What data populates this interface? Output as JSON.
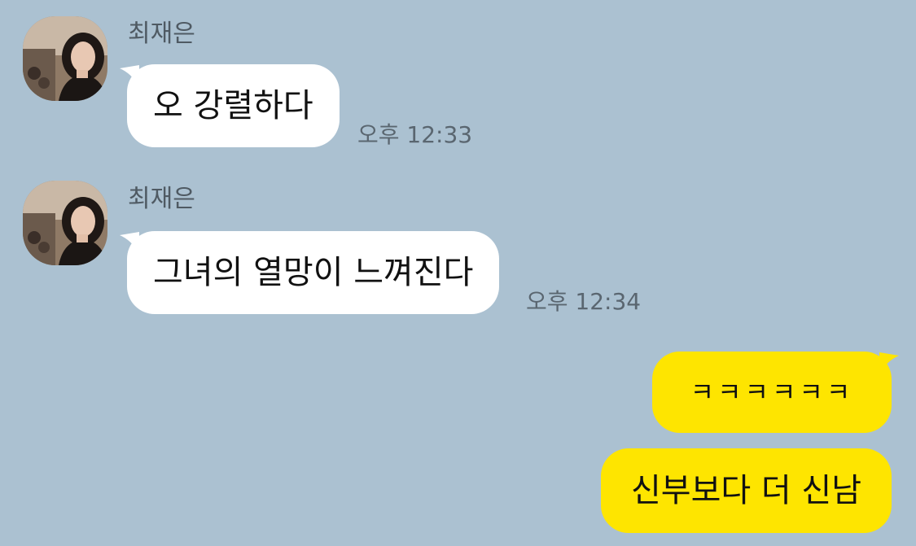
{
  "colors": {
    "background": "#abc1d1",
    "incoming_bubble": "#ffffff",
    "outgoing_bubble": "#fee500"
  },
  "messages": [
    {
      "sender": "최재은",
      "text": "오 강렬하다",
      "time": "오후 12:33",
      "avatar": "profile-photo"
    },
    {
      "sender": "최재은",
      "text": "그녀의 열망이 느껴진다",
      "time": "오후 12:34",
      "avatar": "profile-photo"
    },
    {
      "text": "ㅋㅋㅋㅋㅋㅋ"
    },
    {
      "text": "신부보다 더 신남"
    }
  ]
}
